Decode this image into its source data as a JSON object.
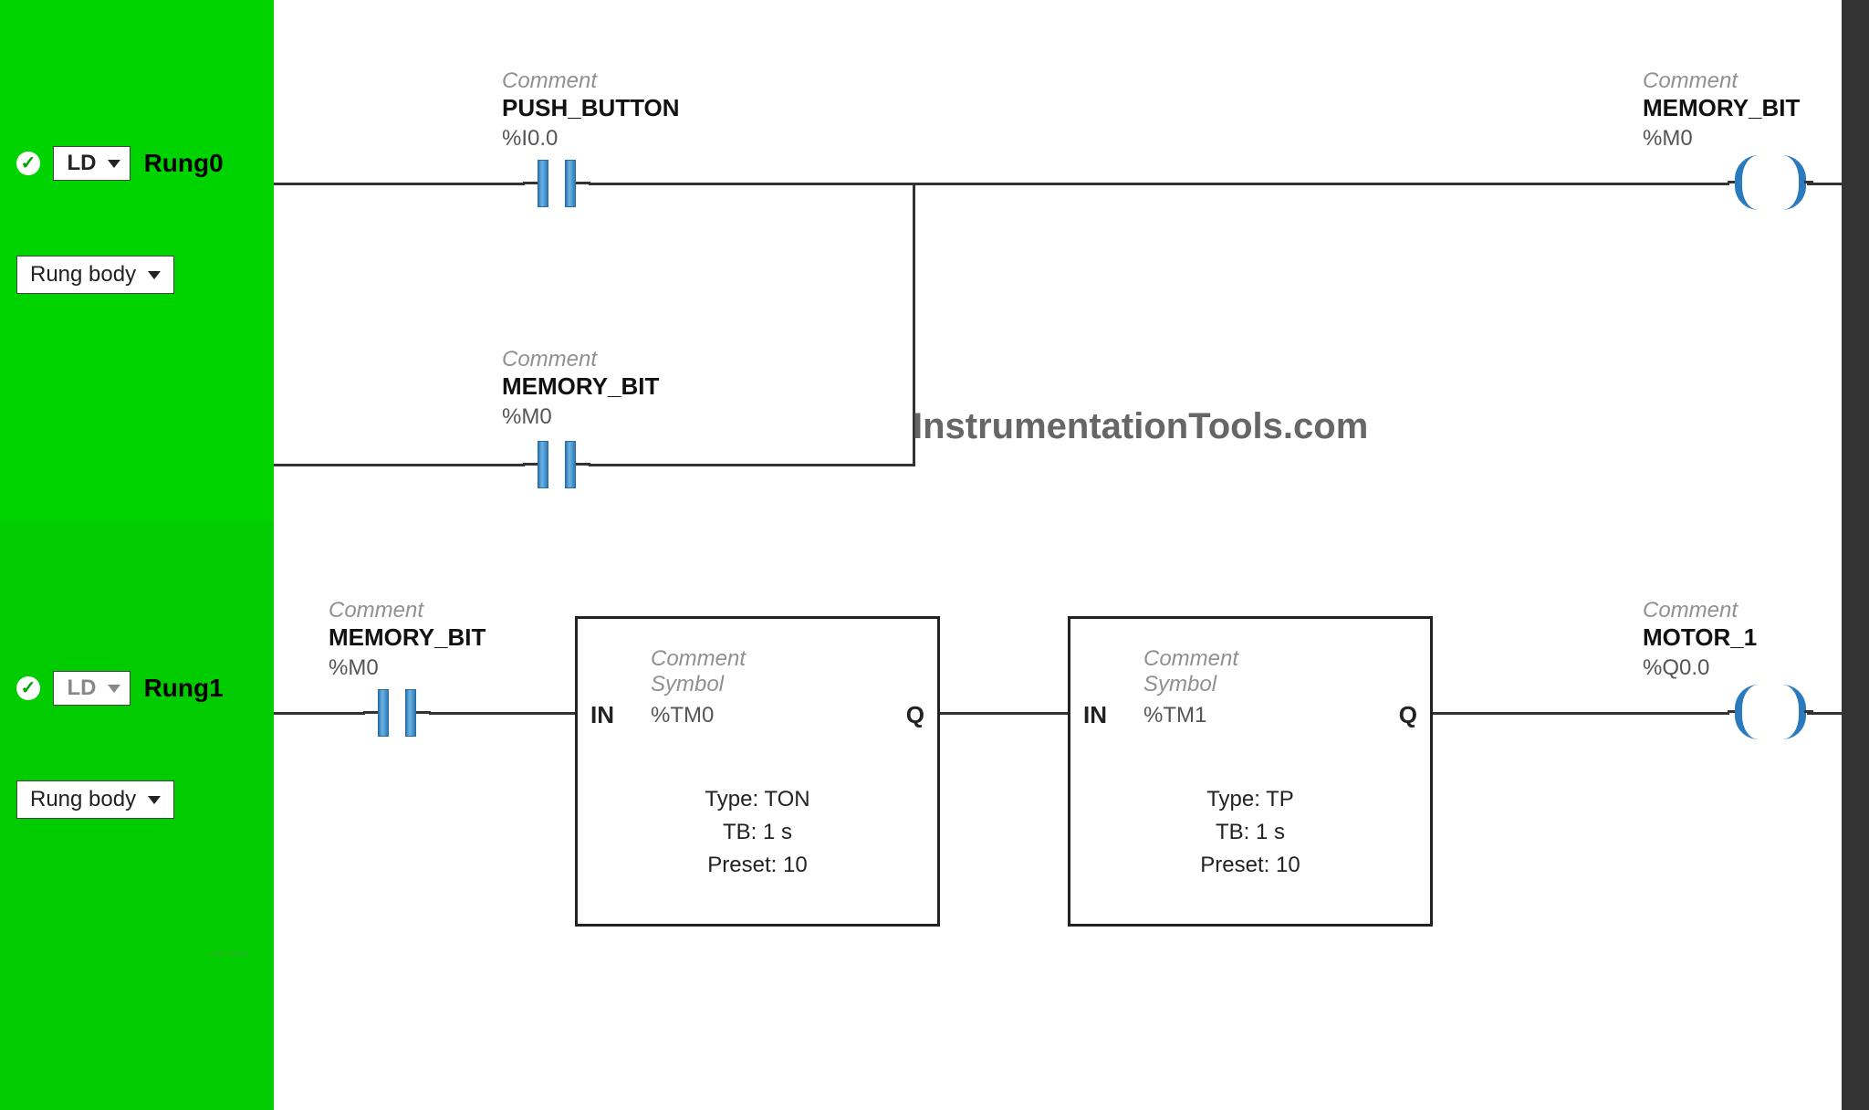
{
  "common": {
    "comment_label": "Comment",
    "symbol_label": "Symbol",
    "rung_body_label": "Rung body",
    "ld_label": "LD",
    "watermark": "InstrumentationTools.com",
    "tiny_watermark": "Inst Tools"
  },
  "rung0": {
    "label": "Rung0",
    "input_contact": {
      "name": "PUSH_BUTTON",
      "addr": "%I0.0"
    },
    "seal_contact": {
      "name": "MEMORY_BIT",
      "addr": "%M0"
    },
    "coil": {
      "name": "MEMORY_BIT",
      "addr": "%M0"
    }
  },
  "rung1": {
    "label": "Rung1",
    "input_contact": {
      "name": "MEMORY_BIT",
      "addr": "%M0"
    },
    "timer0": {
      "addr": "%TM0",
      "type": "Type: TON",
      "tb": "TB: 1 s",
      "preset": "Preset: 10"
    },
    "timer1": {
      "addr": "%TM1",
      "type": "Type: TP",
      "tb": "TB: 1 s",
      "preset": "Preset: 10"
    },
    "coil": {
      "name": "MOTOR_1",
      "addr": "%Q0.0"
    }
  },
  "pins": {
    "in": "IN",
    "q": "Q"
  }
}
